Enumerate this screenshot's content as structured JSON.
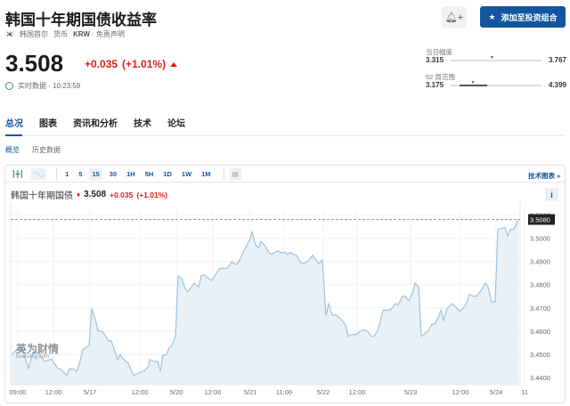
{
  "header": {
    "title": "韩国十年期国债收益率",
    "flag": "KR",
    "exchange": "韩国首尔",
    "currency_label": "货币",
    "currency": "KRW",
    "disclaimer": "· 免责声明",
    "price": "3.508",
    "change": "+0.035",
    "change_pct": "(+1.01%)",
    "realtime": "实时数据 · 10:23:59",
    "add_portfolio": "添加至投资组合"
  },
  "ranges": {
    "day_label": "当日幅度",
    "day_low": "3.315",
    "day_high": "3.767",
    "day_pos": 0.43,
    "week52_label": "52 周范围",
    "w52_low": "3.175",
    "w52_high": "4.399",
    "w52_pos": 0.07
  },
  "tabs": [
    "总况",
    "图表",
    "资讯和分析",
    "技术",
    "论坛"
  ],
  "subtabs": [
    "概览",
    "历史数据"
  ],
  "toolbar": {
    "intervals": [
      "1",
      "5",
      "15",
      "30",
      "1H",
      "5H",
      "1D",
      "1W",
      "1M"
    ],
    "selected": "15",
    "tech_chart": "技术图表 »"
  },
  "legend": {
    "name": "韩国十年期国债",
    "value": "3.508",
    "change": "+0.035",
    "pct": "(+1.01%)",
    "info": "i"
  },
  "watermark": {
    "cn": "英为财情",
    "en": "Investing.com"
  },
  "colors": {
    "accent": "#1256a0",
    "down_up_red": "#d91e18",
    "line": "#9cc3e3",
    "fill": "#e3edf4"
  },
  "chart_data": {
    "type": "area",
    "ylim": [
      3.437,
      3.5124
    ],
    "xlim": [
      0,
      572
    ],
    "last_value": "3.5080",
    "yticks": [
      "3.5100",
      "3.5000",
      "3.4900",
      "3.4800",
      "3.4700",
      "3.4600",
      "3.4500",
      "3.4400"
    ],
    "xticks": [
      [
        8,
        "09:00"
      ],
      [
        48,
        "12:00"
      ],
      [
        89,
        "5/17"
      ],
      [
        145,
        "12:00"
      ],
      [
        186,
        "5/20"
      ],
      [
        227,
        "12:00"
      ],
      [
        269,
        "5/21"
      ],
      [
        307,
        "11:00"
      ],
      [
        351,
        "5/22"
      ],
      [
        389,
        "12:00"
      ],
      [
        449,
        "5/23"
      ],
      [
        505,
        "12:00"
      ],
      [
        545,
        "5/24"
      ],
      [
        577,
        "11"
      ]
    ],
    "points": [
      [
        1,
        3.4498
      ],
      [
        8,
        3.4526
      ],
      [
        13,
        3.4526
      ],
      [
        20,
        3.4438
      ],
      [
        25,
        3.451
      ],
      [
        31,
        3.451
      ],
      [
        38,
        3.447
      ],
      [
        46,
        3.448
      ],
      [
        53,
        3.4438
      ],
      [
        56,
        3.4438
      ],
      [
        63,
        3.441
      ],
      [
        66,
        3.4438
      ],
      [
        70,
        3.4438
      ],
      [
        74,
        3.4426
      ],
      [
        77,
        3.4458
      ],
      [
        81,
        3.4522
      ],
      [
        88,
        3.4538
      ],
      [
        91,
        3.4698
      ],
      [
        95,
        3.465
      ],
      [
        98,
        3.4602
      ],
      [
        103,
        3.4598
      ],
      [
        110,
        3.4558
      ],
      [
        113,
        3.4558
      ],
      [
        120,
        3.4478
      ],
      [
        123,
        3.4498
      ],
      [
        127,
        3.4478
      ],
      [
        132,
        3.4462
      ],
      [
        138,
        3.441
      ],
      [
        145,
        3.4422
      ],
      [
        150,
        3.443
      ],
      [
        155,
        3.445
      ],
      [
        156,
        3.4478
      ],
      [
        161,
        3.447
      ],
      [
        165,
        3.447
      ],
      [
        168,
        3.4426
      ],
      [
        171,
        3.4498
      ],
      [
        175,
        3.4498
      ],
      [
        178,
        3.453
      ],
      [
        181,
        3.4538
      ],
      [
        185,
        3.4578
      ],
      [
        188,
        3.4838
      ],
      [
        192,
        3.4826
      ],
      [
        196,
        3.4782
      ],
      [
        199,
        3.477
      ],
      [
        203,
        3.479
      ],
      [
        206,
        3.4806
      ],
      [
        211,
        3.479
      ],
      [
        214,
        3.4838
      ],
      [
        217,
        3.4842
      ],
      [
        221,
        3.483
      ],
      [
        225,
        3.4818
      ],
      [
        228,
        3.483
      ],
      [
        231,
        3.485
      ],
      [
        235,
        3.487
      ],
      [
        243,
        3.487
      ],
      [
        248,
        3.4898
      ],
      [
        253,
        3.4886
      ],
      [
        256,
        3.4898
      ],
      [
        261,
        3.4938
      ],
      [
        268,
        3.499
      ],
      [
        271,
        3.5026
      ],
      [
        275,
        3.497
      ],
      [
        278,
        3.4958
      ],
      [
        281,
        3.4986
      ],
      [
        285,
        3.497
      ],
      [
        290,
        3.4938
      ],
      [
        293,
        3.493
      ],
      [
        300,
        3.4946
      ],
      [
        303,
        3.4938
      ],
      [
        308,
        3.4938
      ],
      [
        311,
        3.493
      ],
      [
        314,
        3.4938
      ],
      [
        318,
        3.493
      ],
      [
        321,
        3.4926
      ],
      [
        325,
        3.4898
      ],
      [
        328,
        3.489
      ],
      [
        333,
        3.4898
      ],
      [
        336,
        3.491
      ],
      [
        339,
        3.4926
      ],
      [
        343,
        3.4906
      ],
      [
        346,
        3.489
      ],
      [
        350,
        3.4906
      ],
      [
        354,
        3.4666
      ],
      [
        357,
        3.4718
      ],
      [
        361,
        3.467
      ],
      [
        365,
        3.467
      ],
      [
        369,
        3.4658
      ],
      [
        373,
        3.4642
      ],
      [
        376,
        3.4626
      ],
      [
        379,
        3.4578
      ],
      [
        383,
        3.4586
      ],
      [
        388,
        3.4586
      ],
      [
        392,
        3.4598
      ],
      [
        396,
        3.4606
      ],
      [
        401,
        3.4598
      ],
      [
        405,
        3.4578
      ],
      [
        408,
        3.4578
      ],
      [
        412,
        3.4602
      ],
      [
        415,
        3.4642
      ],
      [
        418,
        3.469
      ],
      [
        425,
        3.469
      ],
      [
        428,
        3.4698
      ],
      [
        432,
        3.4718
      ],
      [
        435,
        3.4714
      ],
      [
        440,
        3.475
      ],
      [
        443,
        3.475
      ],
      [
        447,
        3.473
      ],
      [
        451,
        3.4762
      ],
      [
        454,
        3.4806
      ],
      [
        458,
        3.479
      ],
      [
        461,
        3.4578
      ],
      [
        465,
        3.459
      ],
      [
        469,
        3.4602
      ],
      [
        473,
        3.463
      ],
      [
        476,
        3.463
      ],
      [
        480,
        3.4658
      ],
      [
        483,
        3.469
      ],
      [
        486,
        3.4646
      ],
      [
        490,
        3.4698
      ],
      [
        496,
        3.4718
      ],
      [
        501,
        3.4698
      ],
      [
        504,
        3.4686
      ],
      [
        508,
        3.4698
      ],
      [
        512,
        3.4722
      ],
      [
        515,
        3.4758
      ],
      [
        519,
        3.475
      ],
      [
        523,
        3.475
      ],
      [
        528,
        3.4774
      ],
      [
        533,
        3.4806
      ],
      [
        536,
        3.479
      ],
      [
        540,
        3.4726
      ],
      [
        544,
        3.4726
      ],
      [
        547,
        3.5038
      ],
      [
        552,
        3.5042
      ],
      [
        555,
        3.5046
      ],
      [
        558,
        3.501
      ],
      [
        561,
        3.5038
      ],
      [
        565,
        3.5038
      ],
      [
        570,
        3.508
      ]
    ]
  }
}
